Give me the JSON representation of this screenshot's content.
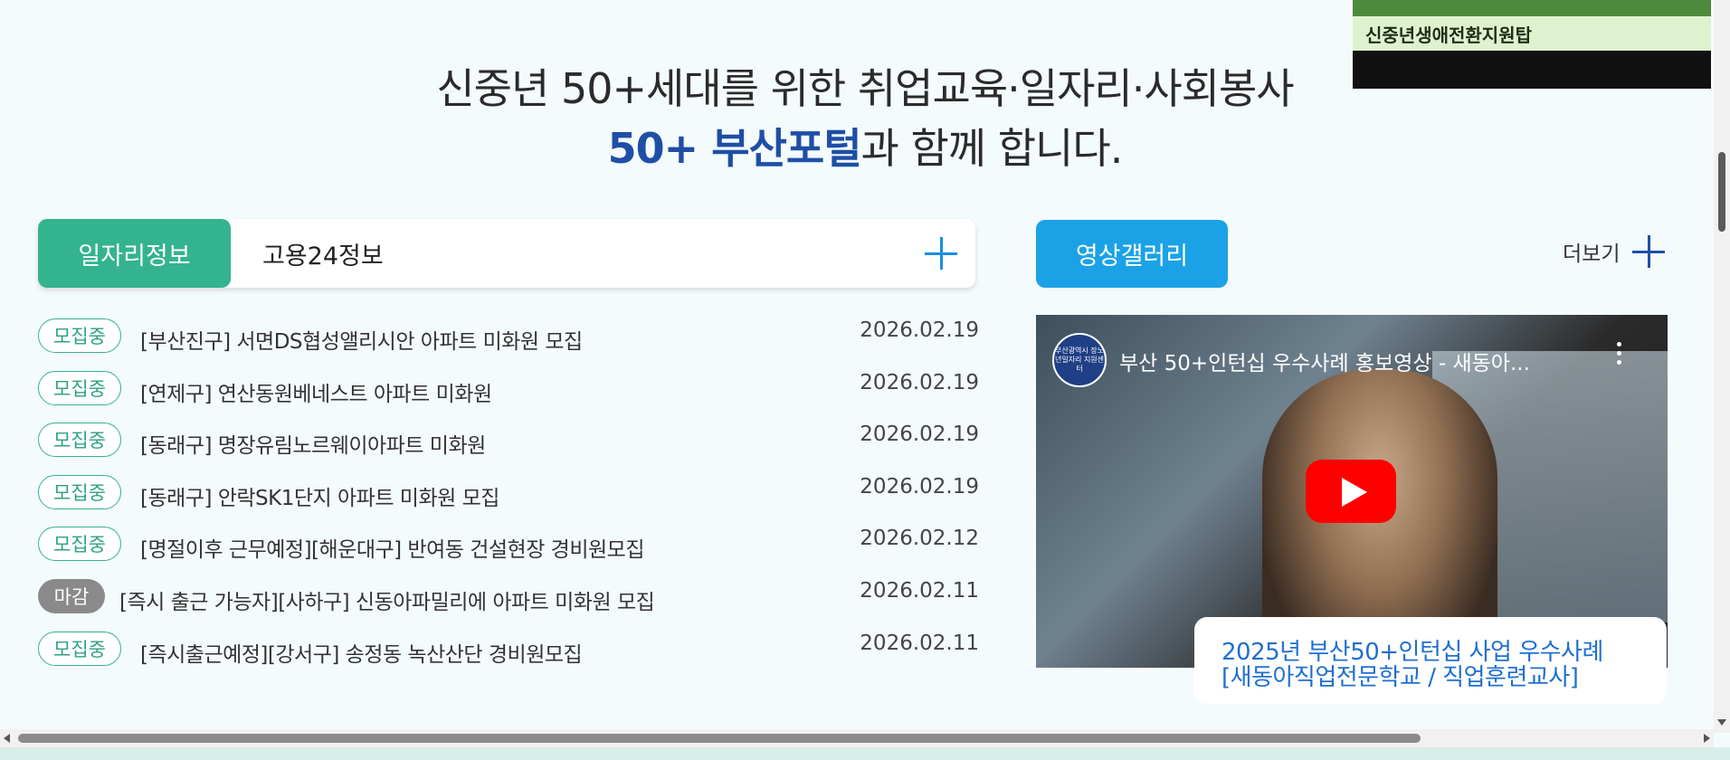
{
  "headline": {
    "line1": "신중년 50+세대를 위한 취업교육·일자리·사회봉사",
    "brand": "50+ 부산포털",
    "line2_rest": "과 함께 합니다."
  },
  "corner_banner": {
    "text": "신중년생애전환지원탑"
  },
  "jobs_panel": {
    "tab_active": "일자리정보",
    "tab_inactive": "고용24정보",
    "items": [
      {
        "status": "모집중",
        "title": "[부산진구] 서면DS협성앨리시안 아파트 미화원 모집",
        "date": "2026.02.19"
      },
      {
        "status": "모집중",
        "title": "[연제구] 연산동원베네스트 아파트 미화원",
        "date": "2026.02.19"
      },
      {
        "status": "모집중",
        "title": "[동래구] 명장유림노르웨이아파트 미화원",
        "date": "2026.02.19"
      },
      {
        "status": "모집중",
        "title": "[동래구] 안락SK1단지 아파트 미화원 모집",
        "date": "2026.02.19"
      },
      {
        "status": "모집중",
        "title": "[명절이후 근무예정][해운대구] 반여동 건설현장 경비원모집",
        "date": "2026.02.12"
      },
      {
        "status": "마감",
        "title": "[즉시 출근 가능자][사하구] 신동아파밀리에 아파트 미화원 모집",
        "date": "2026.02.11"
      },
      {
        "status": "모집중",
        "title": "[즉시출근예정][강서구] 송정동 녹산산단 경비원모집",
        "date": "2026.02.11"
      }
    ]
  },
  "gallery": {
    "button": "영상갤러리",
    "more": "더보기",
    "video_title": "부산 50+인턴십 우수사례 홍보영상 - 새동아...",
    "logo_text": "부산광역시 장노년일자리 지원센터",
    "caption_line1": "2025년 부산50+인턴십 사업 우수사례",
    "caption_line2": "[새동아직업전문학교 / 직업훈련교사]"
  }
}
